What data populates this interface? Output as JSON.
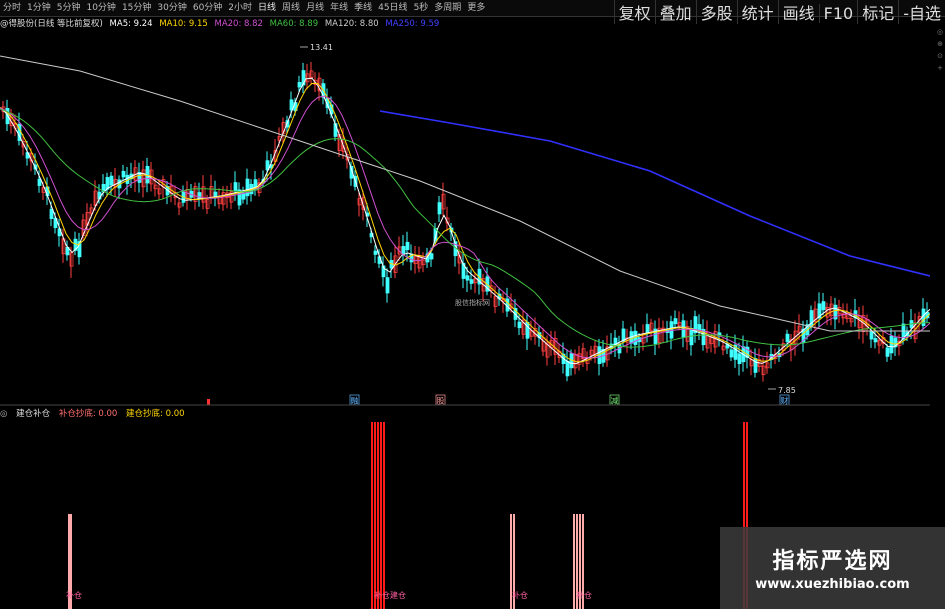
{
  "toolbar": {
    "timeframes": [
      "分时",
      "1分钟",
      "5分钟",
      "10分钟",
      "15分钟",
      "30分钟",
      "60分钟",
      "2小时",
      "日线",
      "周线",
      "月线",
      "年线",
      "季线",
      "45日线",
      "5秒",
      "多周期",
      "更多"
    ],
    "active_timeframe": "日线",
    "right_buttons": [
      "复权",
      "叠加",
      "多股",
      "统计",
      "画线",
      "F10",
      "标记",
      "-自选"
    ]
  },
  "ma_bar": {
    "stock_title": "@得股份(日线 等比前复权)",
    "ma5": "MA5: 9.24",
    "ma10": "MA10: 9.15",
    "ma20": "MA20: 8.82",
    "ma60": "MA60: 8.89",
    "ma120": "MA120: 8.80",
    "ma250": "MA250: 9.59"
  },
  "price_chart": {
    "high_label": "13.41",
    "low_label": "7.85",
    "center_watermark": "股信指标网",
    "event_markers": [
      {
        "label": "融",
        "color": "#5fb4ff"
      },
      {
        "label": "股",
        "color": "#ff9a9a"
      },
      {
        "label": "减",
        "color": "#77ee77"
      },
      {
        "label": "财",
        "color": "#5fb4ff"
      }
    ],
    "colors": {
      "up": "#ff4040",
      "down": "#40ffff",
      "ma5": "#ffffff",
      "ma10": "#ffd700",
      "ma20": "#d050d0",
      "ma60": "#40c040",
      "ma120": "#cccccc",
      "ma250": "#3030ff"
    }
  },
  "indicator": {
    "name": "建仓补仓",
    "line1": "补仓抄底: 0.00",
    "line2": "建仓抄底: 0.00",
    "bar_labels": [
      "补仓",
      "补仓建仓",
      "补仓",
      "补仓"
    ]
  },
  "side_icons": [
    "◎",
    "⊕",
    "⊙",
    "+"
  ],
  "watermark": {
    "title": "指标严选网",
    "url": "www.xuezhibiao.com"
  }
}
